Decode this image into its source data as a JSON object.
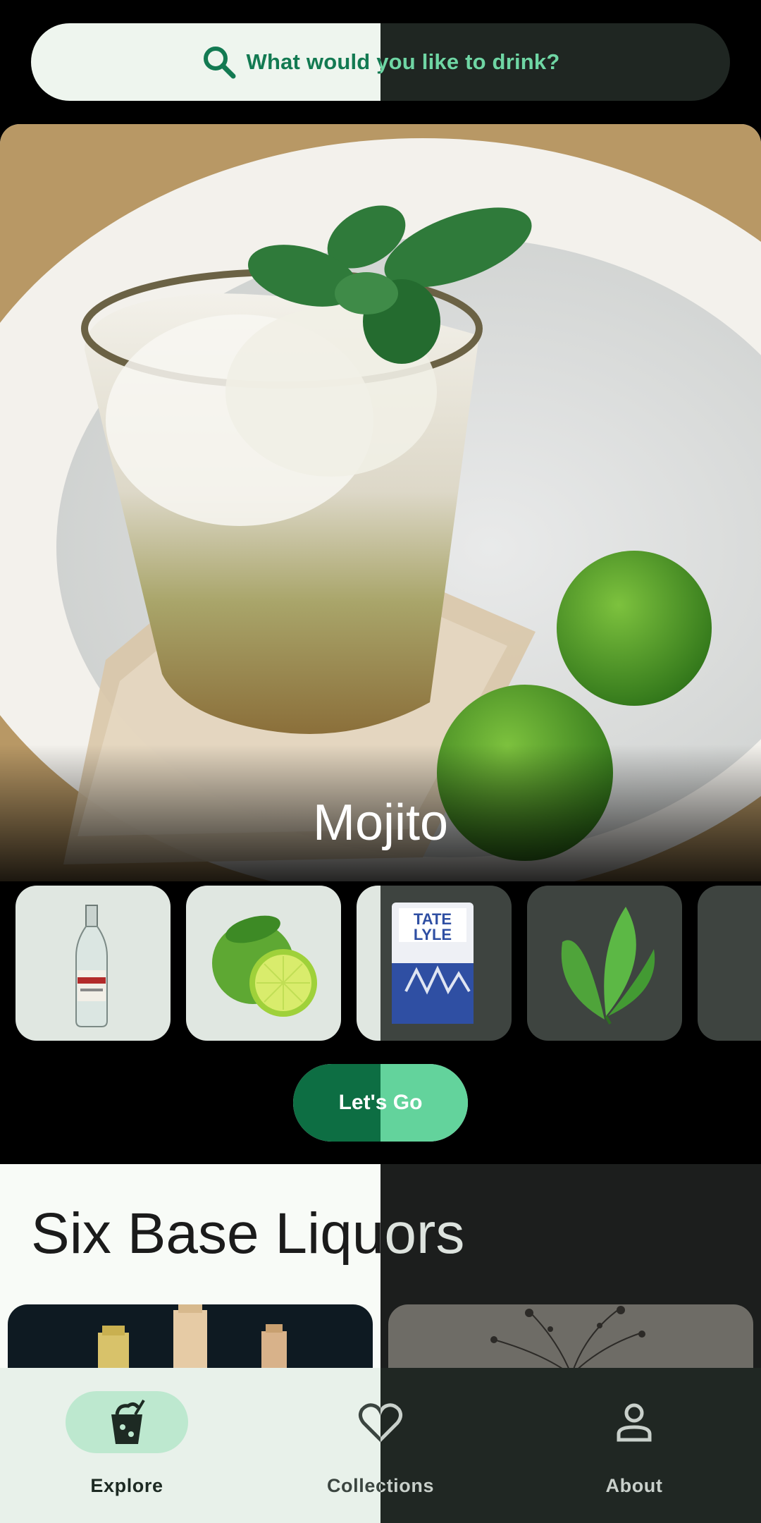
{
  "search": {
    "placeholder": "What would you like to drink?",
    "icon": "search-icon"
  },
  "hero": {
    "title": "Mojito"
  },
  "ingredients": [
    {
      "name": "rum-bottle",
      "icon": "bottle"
    },
    {
      "name": "lime",
      "icon": "lime"
    },
    {
      "name": "sugar-bag",
      "icon": "sugar"
    },
    {
      "name": "mint-leaves",
      "icon": "mint"
    },
    {
      "name": "soda",
      "icon": "partial"
    }
  ],
  "action": {
    "label": "Let's Go"
  },
  "section": {
    "title": "Six Base Liquors"
  },
  "nav": {
    "items": [
      {
        "label": "Explore",
        "icon": "drink-icon",
        "selected": true
      },
      {
        "label": "Collections",
        "icon": "heart-icon",
        "selected": false
      },
      {
        "label": "About",
        "icon": "person-icon",
        "selected": false
      }
    ]
  },
  "colors": {
    "accent": "#137a52",
    "accent_light": "#63d39c",
    "nav_pill": "#bde8cf"
  }
}
